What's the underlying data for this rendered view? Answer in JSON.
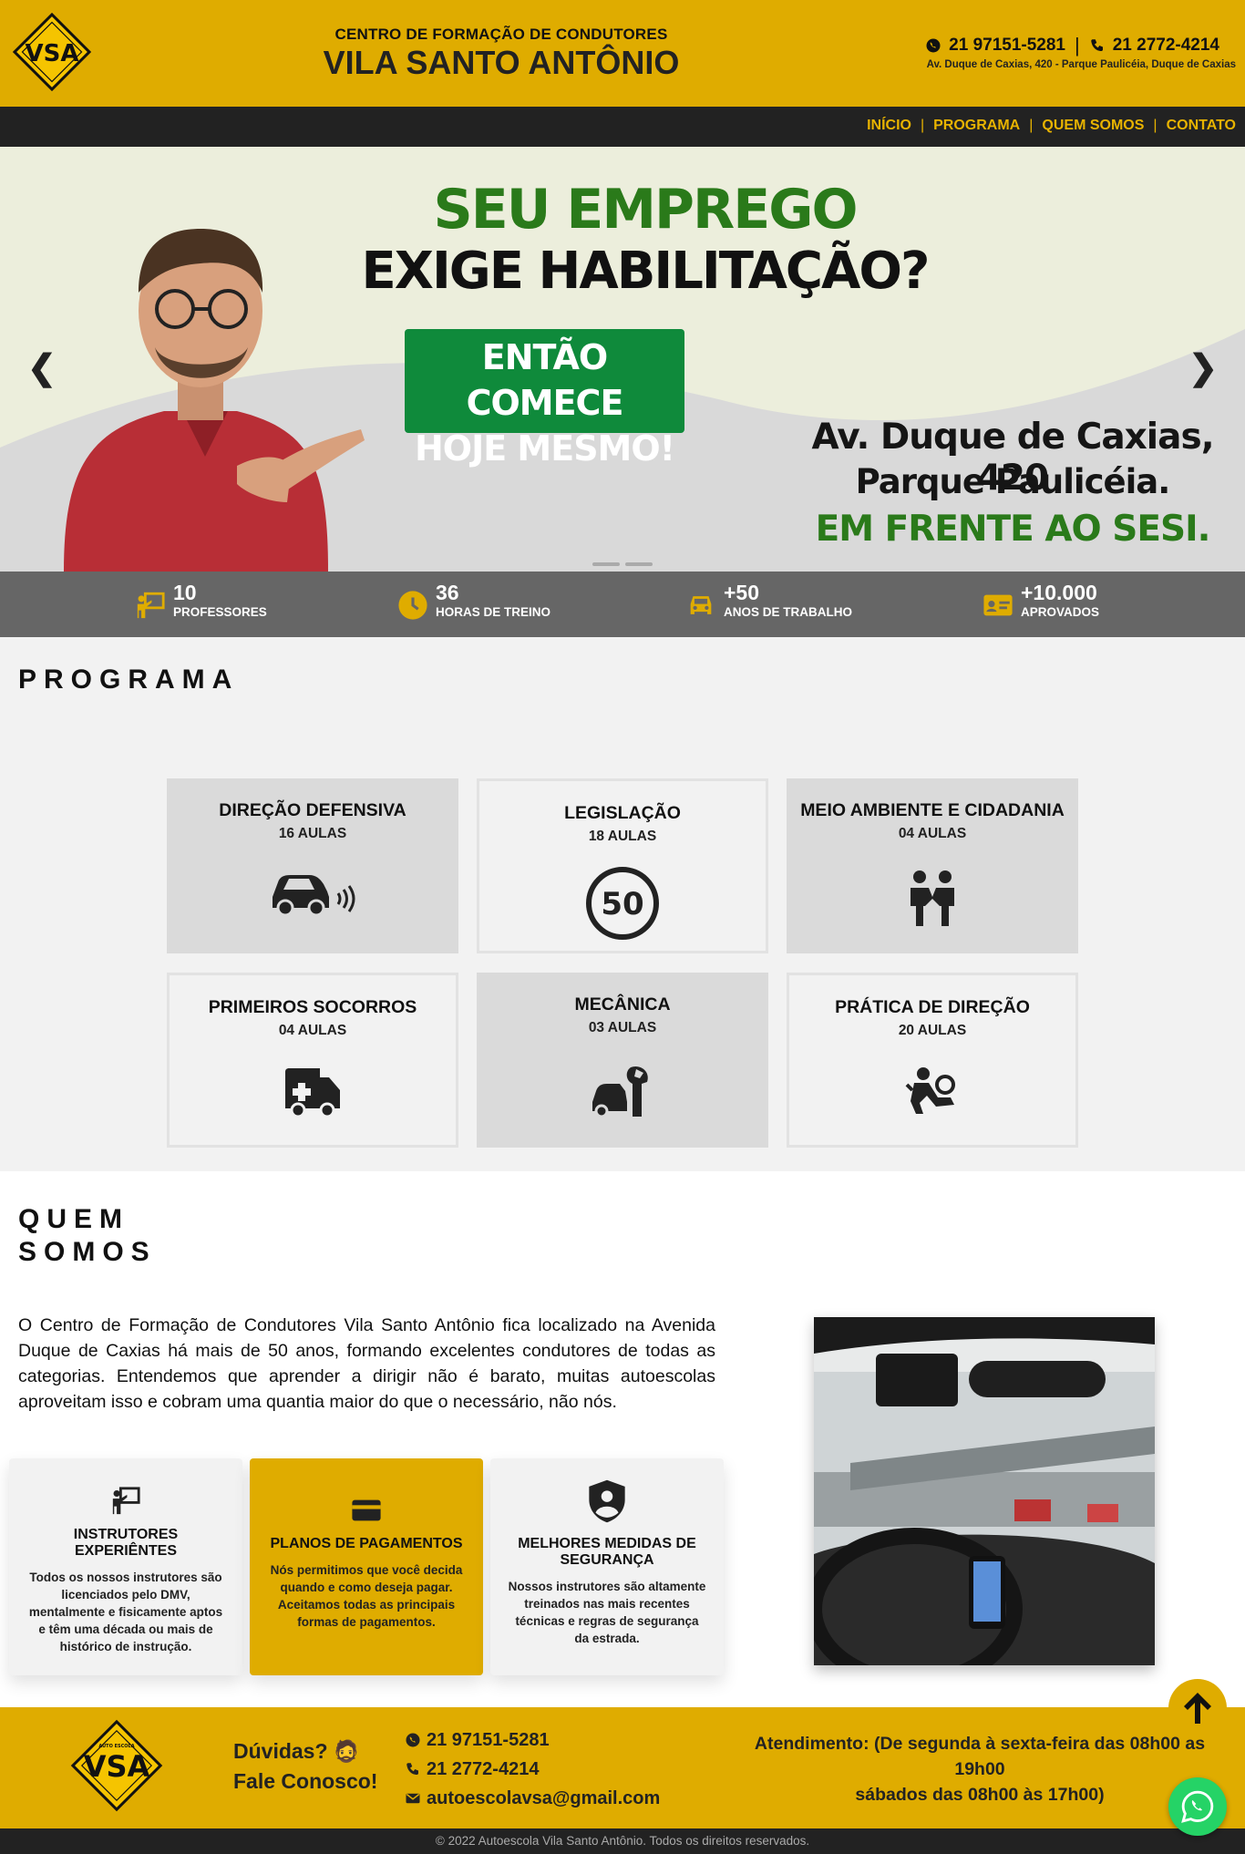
{
  "header": {
    "subtitle": "CENTRO DE FORMAÇÃO DE CONDUTORES",
    "title": "VILA SANTO ANTÔNIO",
    "phone_whatsapp": "21 97151-5281",
    "phone": "21 2772-4214",
    "address": "Av. Duque de Caxias, 420 - Parque Paulicéia, Duque de Caxias",
    "logo_text": "VSA",
    "logo_small": "AUTO ESCOLA"
  },
  "nav": {
    "items": [
      "INÍCIO",
      "PROGRAMA",
      "QUEM SOMOS",
      "CONTATO"
    ]
  },
  "hero": {
    "line1": "SEU EMPREGO",
    "line2": "EXIGE HABILITAÇÃO?",
    "button_line1": "ENTÃO COMECE",
    "button_line2": "HOJE MESMO!",
    "address_line1": "Av. Duque de Caxias, 420",
    "address_line2": "Parque Paulicéia.",
    "address_line3": "EM FRENTE AO SESI.",
    "prev": "❮",
    "next": "❯"
  },
  "stats": [
    {
      "value": "10",
      "label": "PROFESSORES",
      "icon": "teacher-icon"
    },
    {
      "value": "36",
      "label": "HORAS DE TREINO",
      "icon": "clock-icon"
    },
    {
      "value": "+50",
      "label": "ANOS DE TRABALHO",
      "icon": "car-icon"
    },
    {
      "value": "+10.000",
      "label": "APROVADOS",
      "icon": "id-card-icon"
    }
  ],
  "programa": {
    "title": "PROGRAMA",
    "cards": [
      {
        "title": "DIREÇÃO DEFENSIVA",
        "subtitle": "16 AULAS",
        "icon": "car-sensor-icon"
      },
      {
        "title": "LEGISLAÇÃO",
        "subtitle": "18 AULAS",
        "icon": "speed-limit-icon",
        "icon_text": "50"
      },
      {
        "title": "MEIO AMBIENTE E CIDADANIA",
        "subtitle": "04 AULAS",
        "icon": "people-icon"
      },
      {
        "title": "PRIMEIROS SOCORROS",
        "subtitle": "04 AULAS",
        "icon": "ambulance-icon"
      },
      {
        "title": "MECÂNICA",
        "subtitle": "03 AULAS",
        "icon": "car-wrench-icon"
      },
      {
        "title": "PRÁTICA DE DIREÇÃO",
        "subtitle": "20 AULAS",
        "icon": "driver-icon"
      }
    ]
  },
  "quem": {
    "title_line1": "QUEM",
    "title_line2": "SOMOS",
    "text": "O Centro de Formação de Condutores Vila Santo Antônio fica localizado na Avenida Duque de Caxias há mais de 50 anos, formando excelentes condutores de todas as categorias. Entendemos que aprender a dirigir não é barato, muitas autoescolas aproveitam isso e cobram uma quantia maior do que o necessário, não nós.",
    "features": [
      {
        "title": "INSTRUTORES EXPERIÊNTES",
        "desc": "Todos os nossos instrutores são licenciados pelo DMV, mentalmente e fisicamente aptos e têm uma década ou mais de histórico de instrução.",
        "icon": "instructor-icon"
      },
      {
        "title": "PLANOS DE PAGAMENTOS",
        "desc": "Nós permitimos que você decida quando e como deseja pagar. Aceitamos todas as principais formas de pagamentos.",
        "icon": "credit-card-icon"
      },
      {
        "title": "MELHORES MEDIDAS DE SEGURANÇA",
        "desc": "Nossos instrutores são altamente treinados nas mais recentes técnicas e regras de segurança da estrada.",
        "icon": "shield-user-icon"
      }
    ]
  },
  "footer": {
    "duvidas_line1": "Dúvidas? 🧔",
    "duvidas_line2": "Fale Conosco!",
    "whatsapp": "21 97151-5281",
    "phone": "21 2772-4214",
    "email": "autoescolavsa@gmail.com",
    "hours_line1": "Atendimento: (De segunda à sexta-feira das 08h00 as",
    "hours_line2": "19h00",
    "hours_line3": "sábados das 08h00 às 17h00)",
    "copyright": "© 2022 Autoescola Vila Santo Antônio. Todos os direitos reservados."
  },
  "colors": {
    "brand_yellow": "#dfac00",
    "dark": "#222222",
    "hero_green": "#2a7a1a",
    "button_green": "#0f8a3b",
    "whatsapp_green": "#25d366"
  }
}
